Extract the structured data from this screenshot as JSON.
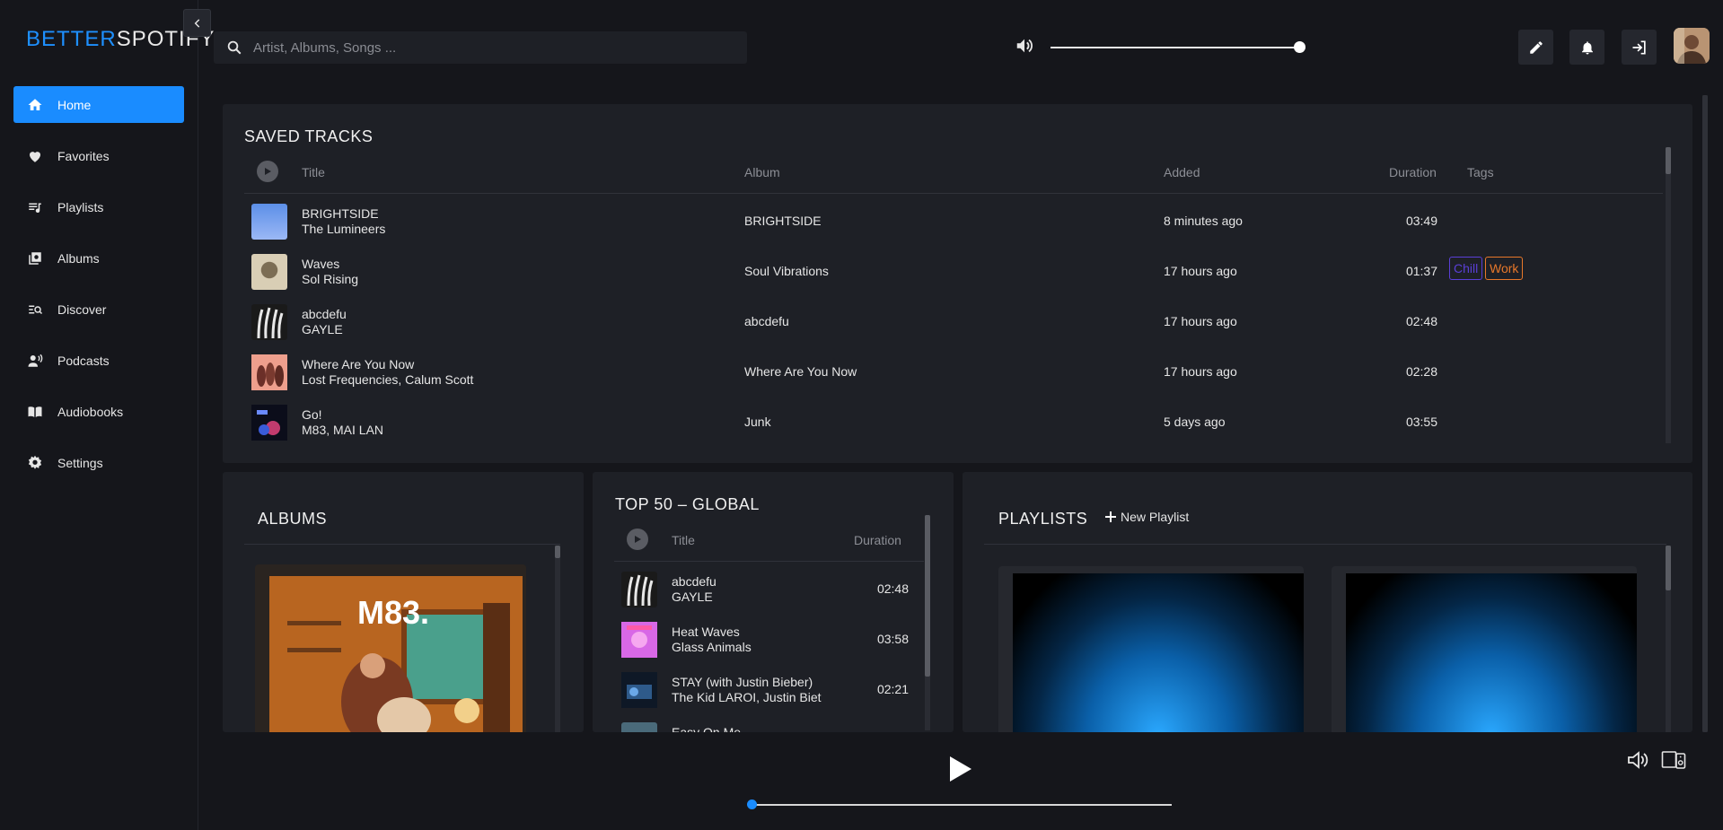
{
  "app": {
    "logo_part1": "BETTER",
    "logo_part2": "SPOTIFY"
  },
  "nav": {
    "items": [
      {
        "label": "Home",
        "icon": "home-icon",
        "active": true
      },
      {
        "label": "Favorites",
        "icon": "heart-icon"
      },
      {
        "label": "Playlists",
        "icon": "playlist-icon"
      },
      {
        "label": "Albums",
        "icon": "album-icon"
      },
      {
        "label": "Discover",
        "icon": "discover-icon"
      },
      {
        "label": "Podcasts",
        "icon": "podcast-icon"
      },
      {
        "label": "Audiobooks",
        "icon": "audiobook-icon"
      },
      {
        "label": "Settings",
        "icon": "gear-icon"
      }
    ]
  },
  "search": {
    "placeholder": "Artist, Albums, Songs ..."
  },
  "volume": {
    "level": 1.0
  },
  "saved_tracks": {
    "title": "SAVED TRACKS",
    "headers": {
      "title": "Title",
      "album": "Album",
      "added": "Added",
      "duration": "Duration",
      "tags": "Tags"
    },
    "rows": [
      {
        "title": "BRIGHTSIDE",
        "artist": "The Lumineers",
        "album": "BRIGHTSIDE",
        "added": "8 minutes ago",
        "duration": "03:49",
        "tags": []
      },
      {
        "title": "Waves",
        "artist": "Sol Rising",
        "album": "Soul Vibrations",
        "added": "17 hours ago",
        "duration": "01:37",
        "tags": [
          "Chill",
          "Work"
        ]
      },
      {
        "title": "abcdefu",
        "artist": "GAYLE",
        "album": "abcdefu",
        "added": "17 hours ago",
        "duration": "02:48",
        "tags": []
      },
      {
        "title": "Where Are You Now",
        "artist": "Lost Frequencies, Calum Scott",
        "album": "Where Are You Now",
        "added": "17 hours ago",
        "duration": "02:28",
        "tags": []
      },
      {
        "title": "Go!",
        "artist": "M83, MAI LAN",
        "album": "Junk",
        "added": "5 days ago",
        "duration": "03:55",
        "tags": []
      }
    ],
    "tag_colors": {
      "Chill": "#5a3fd6",
      "Work": "#e8782a"
    }
  },
  "albums": {
    "title": "ALBUMS",
    "cover_text": "M83."
  },
  "top50": {
    "title": "TOP 50 – GLOBAL",
    "headers": {
      "title": "Title",
      "duration": "Duration"
    },
    "rows": [
      {
        "title": "abcdefu",
        "artist": "GAYLE",
        "duration": "02:48"
      },
      {
        "title": "Heat Waves",
        "artist": "Glass Animals",
        "duration": "03:58"
      },
      {
        "title": "STAY (with Justin Bieber)",
        "artist": "The Kid LAROI, Justin Biet",
        "duration": "02:21"
      },
      {
        "title": "Easy On Me",
        "artist": "",
        "duration": ""
      }
    ]
  },
  "playlists": {
    "title": "PLAYLISTS",
    "new_label": "New Playlist"
  },
  "player": {
    "progress": 0.0
  },
  "colors": {
    "accent": "#1a8cff",
    "background": "#15161b",
    "panel": "#1e2026"
  }
}
